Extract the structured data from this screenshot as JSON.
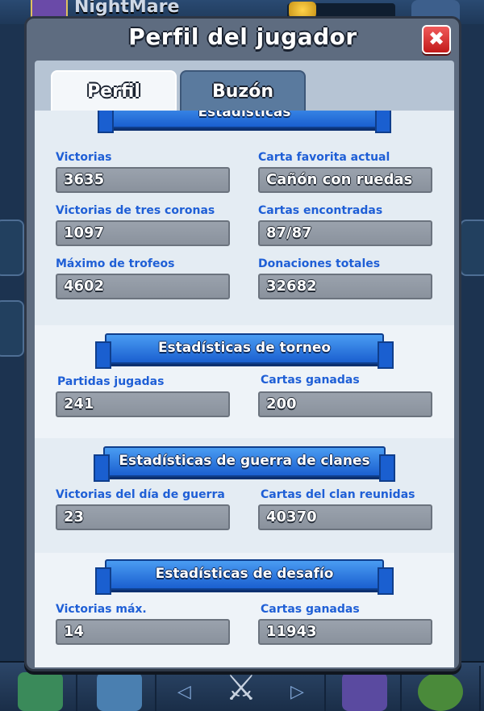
{
  "background": {
    "player_name": "NightMare"
  },
  "modal": {
    "title": "Perfil del jugador",
    "close_symbol": "✖",
    "tabs": [
      {
        "label": "Perfil",
        "active": true
      },
      {
        "label": "Buzón",
        "active": false
      }
    ]
  },
  "sections": [
    {
      "title": "Estadísticas",
      "stats": [
        {
          "label": "Victorias",
          "value": "3635"
        },
        {
          "label": "Carta favorita actual",
          "value": "Cañón con ruedas"
        },
        {
          "label": "Victorias de tres coronas",
          "value": "1097"
        },
        {
          "label": "Cartas encontradas",
          "value": "87/87"
        },
        {
          "label": "Máximo de trofeos",
          "value": "4602"
        },
        {
          "label": "Donaciones totales",
          "value": "32682"
        }
      ]
    },
    {
      "title": "Estadísticas de torneo",
      "stats": [
        {
          "label": "Partidas jugadas",
          "value": "241"
        },
        {
          "label": "Cartas ganadas",
          "value": "200"
        }
      ]
    },
    {
      "title": "Estadísticas de guerra de clanes",
      "stats": [
        {
          "label": "Victorias del día de guerra",
          "value": "23"
        },
        {
          "label": "Cartas del clan reunidas",
          "value": "40370"
        }
      ]
    },
    {
      "title": "Estadísticas de desafío",
      "stats": [
        {
          "label": "Victorias máx.",
          "value": "14"
        },
        {
          "label": "Cartas ganadas",
          "value": "11943"
        }
      ]
    }
  ],
  "bottom_nav": {
    "left_arrow": "◁",
    "right_arrow": "▷",
    "battle_icon": "⚔"
  },
  "colors": {
    "label_blue": "#1f5fd6",
    "ribbon_blue": "#2a7be8",
    "close_red": "#d92b2b"
  }
}
